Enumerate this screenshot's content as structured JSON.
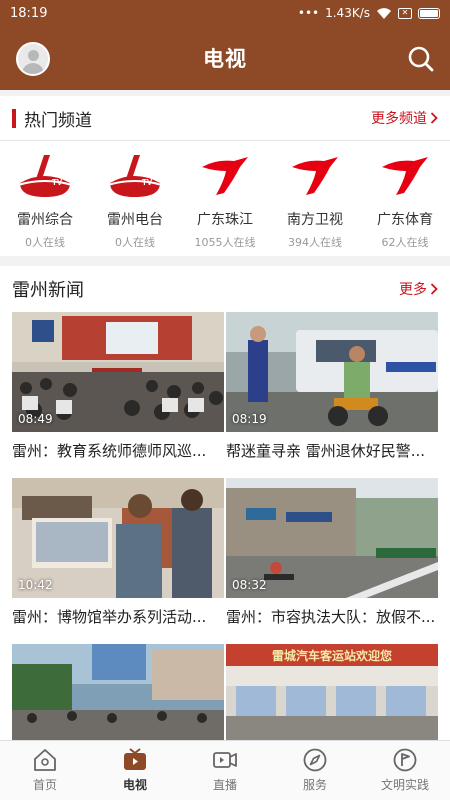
{
  "status_bar": {
    "time": "18:19",
    "dots": "•••",
    "net_speed": "1.43K/s",
    "sim": "✕"
  },
  "header": {
    "title": "电视"
  },
  "hot_channels": {
    "title": "热门频道",
    "more_label": "更多频道",
    "items": [
      {
        "name": "雷州综合",
        "online": "0人在线",
        "logo": "leizhou-tv-logo"
      },
      {
        "name": "雷州电台",
        "online": "0人在线",
        "logo": "leizhou-tv-logo"
      },
      {
        "name": "广东珠江",
        "online": "1055人在线",
        "logo": "guangdong-tv-logo"
      },
      {
        "name": "南方卫视",
        "online": "394人在线",
        "logo": "guangdong-tv-logo"
      },
      {
        "name": "广东体育",
        "online": "62人在线",
        "logo": "guangdong-tv-logo"
      }
    ]
  },
  "news": {
    "title": "雷州新闻",
    "more_label": "更多",
    "items": [
      {
        "title": "雷州：教育系统师德师风巡...",
        "duration": "08:49"
      },
      {
        "title": "帮迷童寻亲 雷州退休好民警...",
        "duration": "08:19"
      },
      {
        "title": "雷州：博物馆举办系列活动...",
        "duration": "10:42"
      },
      {
        "title": "雷州：市容执法大队：放假不...",
        "duration": "08:32"
      },
      {
        "title": "",
        "duration": ""
      },
      {
        "title": "",
        "duration": ""
      }
    ],
    "banner_text": "雷城汽车客运站欢迎您"
  },
  "tabbar": {
    "items": [
      {
        "label": "首页",
        "icon": "home-icon"
      },
      {
        "label": "电视",
        "icon": "tv-icon"
      },
      {
        "label": "直播",
        "icon": "video-camera-icon"
      },
      {
        "label": "服务",
        "icon": "compass-icon"
      },
      {
        "label": "文明实践",
        "icon": "flag-icon"
      }
    ],
    "active": "电视"
  },
  "colors": {
    "brand": "#8e4a26",
    "accent": "#c8161d"
  }
}
